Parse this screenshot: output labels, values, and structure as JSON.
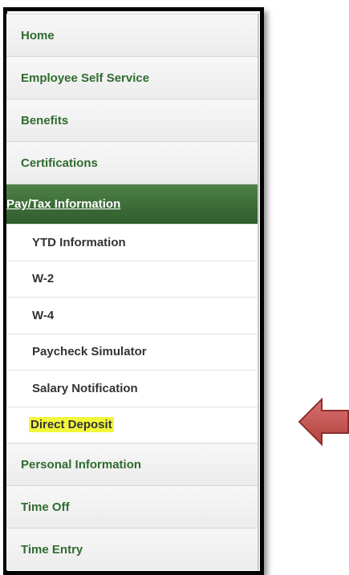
{
  "menu": {
    "items": [
      {
        "label": "Home"
      },
      {
        "label": "Employee Self Service"
      },
      {
        "label": "Benefits"
      },
      {
        "label": "Certifications"
      },
      {
        "label": "Pay/Tax Information"
      },
      {
        "label": "YTD Information"
      },
      {
        "label": "W-2"
      },
      {
        "label": "W-4"
      },
      {
        "label": "Paycheck Simulator"
      },
      {
        "label": "Salary Notification"
      },
      {
        "label": "Direct Deposit"
      },
      {
        "label": "Personal Information"
      },
      {
        "label": "Time Off"
      },
      {
        "label": "Time Entry"
      }
    ]
  },
  "colors": {
    "link_green": "#2f6b2f",
    "active_bg": "#3f6e39",
    "highlight": "#f3f73a",
    "arrow_fill": "#c0504d"
  },
  "annotation": {
    "icon": "left-arrow-icon"
  }
}
